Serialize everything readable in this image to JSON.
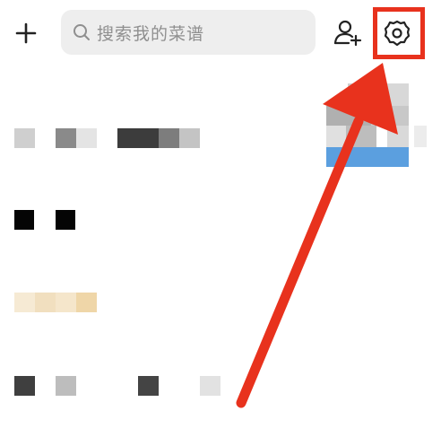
{
  "header": {
    "add_icon": "plus-icon",
    "search": {
      "icon": "search-icon",
      "placeholder": "搜索我的菜谱"
    },
    "add_friend_icon": "add-user-icon",
    "settings_icon": "gear-icon"
  },
  "annotation": {
    "highlight_target": "settings-button",
    "color": "#e8321d"
  },
  "colors": {
    "search_bg": "#eeeeee",
    "placeholder": "#8f8f8f",
    "icon": "#222222",
    "annotation": "#e8321d"
  }
}
